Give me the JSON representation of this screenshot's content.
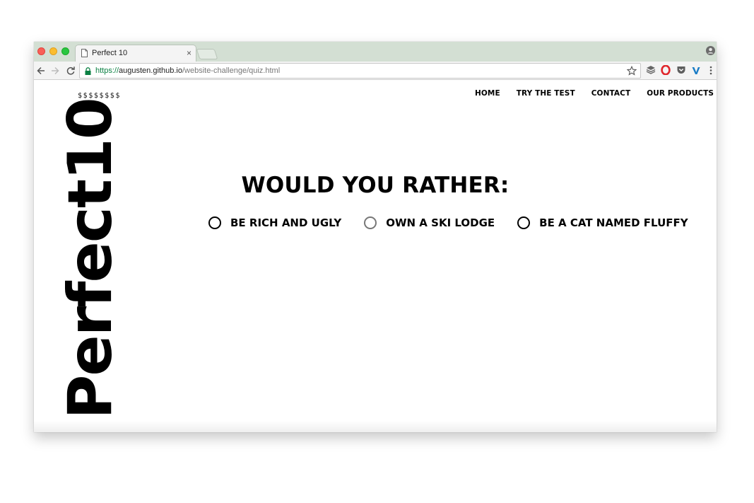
{
  "browser": {
    "tab_title": "Perfect 10",
    "tab_close": "×",
    "url_scheme": "https://",
    "url_host": "augusten.github.io",
    "url_path": "/website-challenge/quiz.html",
    "icons": [
      "close-window-icon",
      "minimize-window-icon",
      "maximize-window-icon",
      "document-icon",
      "new-tab-icon",
      "profile-icon",
      "back-icon",
      "forward-icon",
      "reload-icon",
      "lock-icon",
      "star-icon",
      "extension-icon",
      "opera-icon",
      "pocket-icon",
      "vimeo-icon",
      "menu-icon"
    ],
    "colors": {
      "tabbar": "#d3dfd3",
      "secure": "#0b8043",
      "close": "#f95f57",
      "minimize": "#fbbd2e",
      "maximize": "#29c640"
    }
  },
  "site": {
    "tagline": "$$$$$$$$",
    "logo": "Perfect10",
    "nav": [
      {
        "label": "HOME"
      },
      {
        "label": "TRY THE TEST"
      },
      {
        "label": "CONTACT"
      },
      {
        "label": "OUR PRODUCTS"
      }
    ],
    "question": "WOULD YOU RATHER:",
    "options": [
      {
        "label": "BE RICH AND UGLY"
      },
      {
        "label": "OWN A SKI LODGE"
      },
      {
        "label": "BE A CAT NAMED FLUFFY"
      }
    ]
  }
}
